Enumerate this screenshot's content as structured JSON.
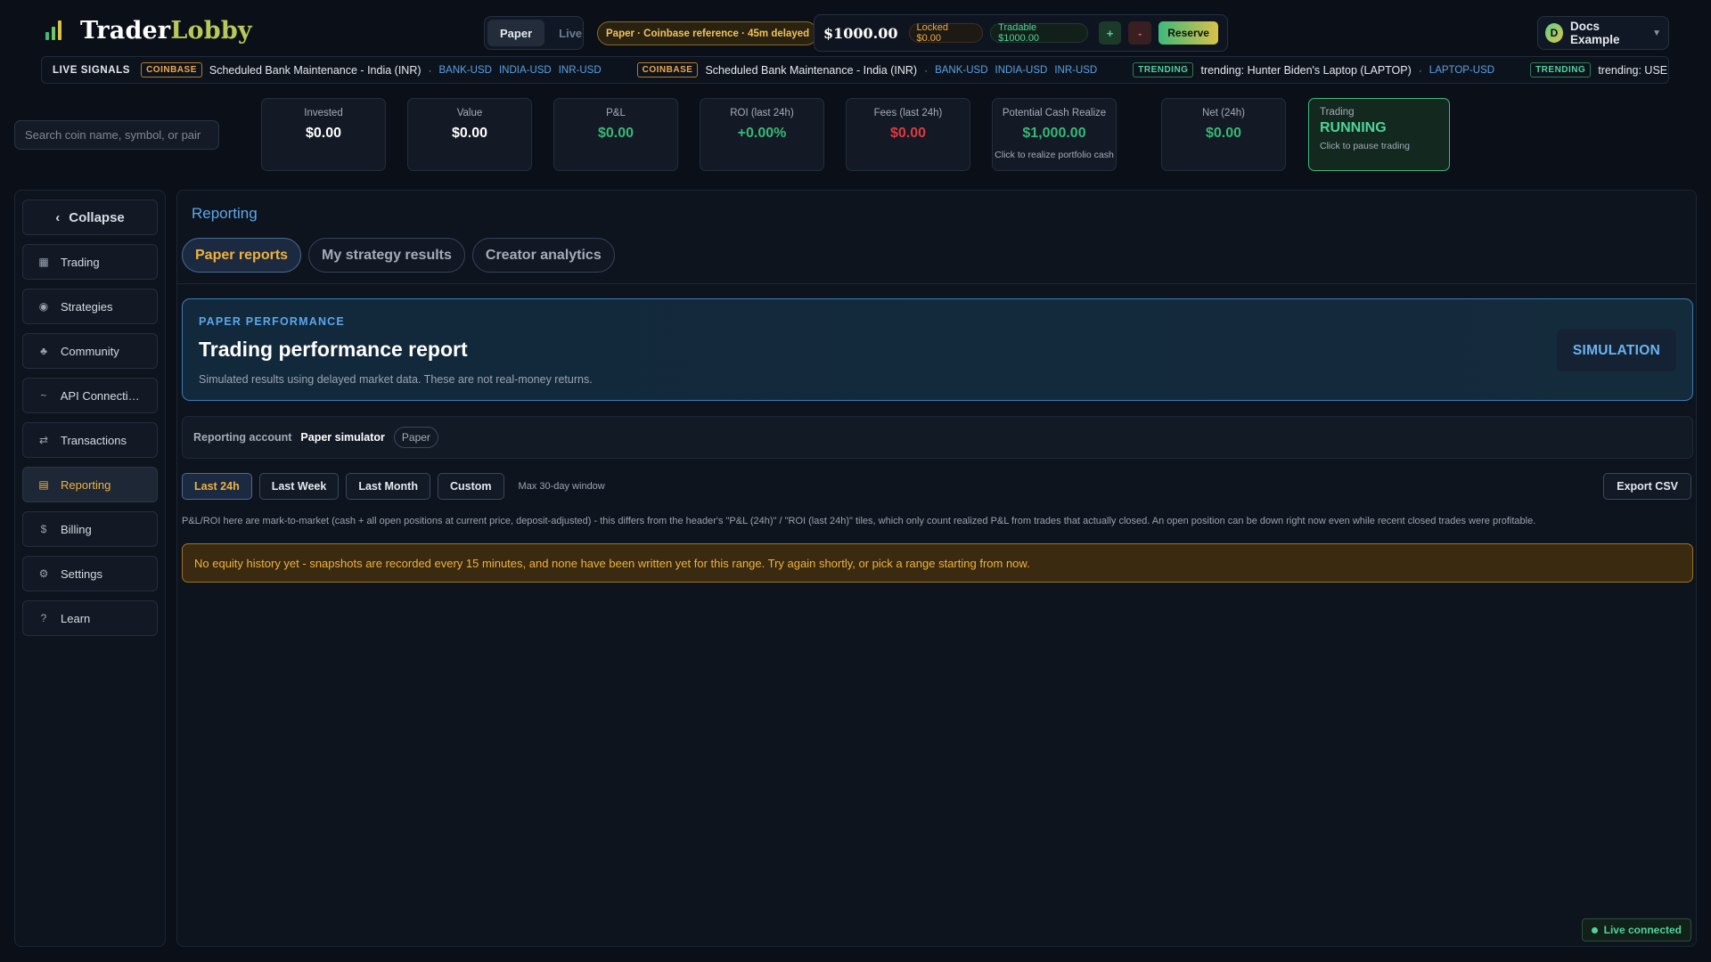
{
  "colors": {
    "accent_gold": "#f0b23e",
    "accent_blue": "#5aa8ee",
    "positive": "#37b874",
    "negative": "#e0393e",
    "logo_green": "#b9c85a"
  },
  "header": {
    "logo_part1": "Trader",
    "logo_part2": "Lobby",
    "logo_icon": "bar-chart-icon",
    "mode_options": [
      "Paper",
      "Live"
    ],
    "mode_selected": "Paper",
    "reference_label": "Paper · Coinbase reference · 45m delayed",
    "balance": "$1000.00",
    "locked": "Locked $0.00",
    "tradable": "Tradable $1000.00",
    "plus_label": "+",
    "minus_label": "-",
    "reserve_label": "Reserve",
    "user_initial": "D",
    "user_name": "Docs Example",
    "user_chevron": "▼"
  },
  "ticker": {
    "label": "LIVE SIGNALS",
    "items": [
      {
        "tag": "COINBASE",
        "tag_type": "coinbase",
        "text": "Scheduled Bank Maintenance - India (INR)",
        "symbols": [
          "BANK-USD",
          "INDIA-USD",
          "INR-USD"
        ]
      },
      {
        "tag": "COINBASE",
        "tag_type": "coinbase",
        "text": "Scheduled Bank Maintenance - India (INR)",
        "symbols": [
          "BANK-USD",
          "INDIA-USD",
          "INR-USD"
        ]
      },
      {
        "tag": "TRENDING",
        "tag_type": "trending",
        "text": "trending: Hunter Biden's Laptop (LAPTOP)",
        "symbols": [
          "LAPTOP-USD"
        ]
      },
      {
        "tag": "TRENDING",
        "tag_type": "trending",
        "text": "trending: USELESS STONK (STONK",
        "symbols": []
      }
    ]
  },
  "search": {
    "placeholder": "Search coin name, symbol, or pair"
  },
  "stats": {
    "invested": {
      "label": "Invested",
      "value": "$0.00"
    },
    "value": {
      "label": "Value",
      "value": "$0.00"
    },
    "pnl": {
      "label": "P&L",
      "value": "$0.00"
    },
    "roi": {
      "label": "ROI (last 24h)",
      "value": "+0.00%"
    },
    "fees": {
      "label": "Fees (last 24h)",
      "value": "$0.00"
    },
    "potential": {
      "label": "Potential Cash Realize",
      "value": "$1,000.00",
      "sub": "Click to realize portfolio cash"
    },
    "net": {
      "label": "Net (24h)",
      "value": "$0.00"
    },
    "trading": {
      "label": "Trading",
      "state": "RUNNING",
      "sub": "Click to pause trading"
    }
  },
  "sidebar": {
    "collapse_label": "Collapse",
    "collapse_icon": "‹",
    "items": [
      {
        "key": "trading",
        "label": "Trading",
        "icon": "▦",
        "active": false
      },
      {
        "key": "strategies",
        "label": "Strategies",
        "icon": "◉",
        "active": false
      },
      {
        "key": "community",
        "label": "Community",
        "icon": "♣",
        "active": false
      },
      {
        "key": "api-connections",
        "label": "API Connectio...",
        "icon": "~",
        "active": false
      },
      {
        "key": "transactions",
        "label": "Transactions",
        "icon": "⇄",
        "active": false
      },
      {
        "key": "reporting",
        "label": "Reporting",
        "icon": "▤",
        "active": true
      },
      {
        "key": "billing",
        "label": "Billing",
        "icon": "$",
        "active": false
      },
      {
        "key": "settings",
        "label": "Settings",
        "icon": "⚙",
        "active": false
      },
      {
        "key": "learn",
        "label": "Learn",
        "icon": "?",
        "active": false
      }
    ]
  },
  "main": {
    "title": "Reporting",
    "tabs": [
      {
        "label": "Paper reports",
        "active": true
      },
      {
        "label": "My strategy results",
        "active": false
      },
      {
        "label": "Creator analytics",
        "active": false
      }
    ],
    "perf_card": {
      "kicker": "PAPER PERFORMANCE",
      "title": "Trading performance report",
      "subtitle": "Simulated results using delayed market data. These are not real-money returns.",
      "badge": "SIMULATION"
    },
    "account": {
      "label": "Reporting account",
      "name": "Paper simulator",
      "type": "Paper"
    },
    "ranges": [
      {
        "label": "Last 24h",
        "active": true
      },
      {
        "label": "Last Week",
        "active": false
      },
      {
        "label": "Last Month",
        "active": false
      },
      {
        "label": "Custom",
        "active": false
      }
    ],
    "range_note": "Max 30-day window",
    "export_label": "Export CSV",
    "note": "P&L/ROI here are mark-to-market (cash + all open positions at current price, deposit-adjusted) - this differs from the header's \"P&L (24h)\" / \"ROI (last 24h)\" tiles, which only count realized P&L from trades that actually closed. An open position can be down right now even while recent closed trades were profitable.",
    "warning": "No equity history yet - snapshots are recorded every 15 minutes, and none have been written yet for this range. Try again shortly, or pick a range starting from now.",
    "live_status": "Live connected"
  }
}
